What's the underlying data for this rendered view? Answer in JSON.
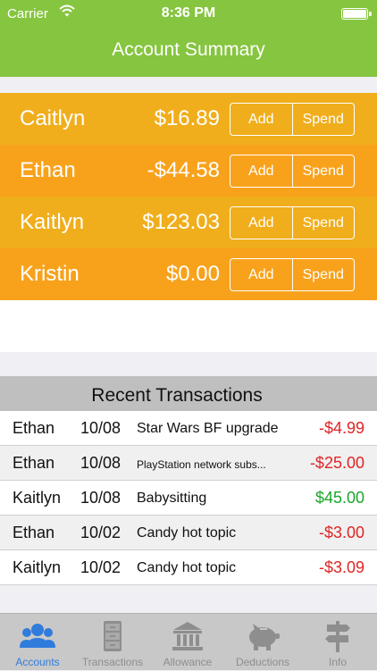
{
  "status": {
    "carrier": "Carrier",
    "time": "8:36 PM"
  },
  "header": {
    "title": "Account Summary"
  },
  "accounts": [
    {
      "name": "Caitlyn",
      "balance": "$16.89",
      "add": "Add",
      "spend": "Spend",
      "color": "#f0ae1c"
    },
    {
      "name": "Ethan",
      "balance": "-$44.58",
      "add": "Add",
      "spend": "Spend",
      "color": "#f8a21c"
    },
    {
      "name": "Kaitlyn",
      "balance": "$123.03",
      "add": "Add",
      "spend": "Spend",
      "color": "#f0ae1c"
    },
    {
      "name": "Kristin",
      "balance": "$0.00",
      "add": "Add",
      "spend": "Spend",
      "color": "#f8a21c"
    }
  ],
  "recent": {
    "title": "Recent Transactions",
    "rows": [
      {
        "who": "Ethan",
        "date": "10/08",
        "desc": "Star Wars BF upgrade",
        "amount": "-$4.99",
        "color": "#e02424"
      },
      {
        "who": "Ethan",
        "date": "10/08",
        "desc": "PlayStation network subs...",
        "amount": "-$25.00",
        "color": "#e02424"
      },
      {
        "who": "Kaitlyn",
        "date": "10/08",
        "desc": "Babysitting",
        "amount": "$45.00",
        "color": "#1aa52a"
      },
      {
        "who": "Ethan",
        "date": "10/02",
        "desc": "Candy hot topic",
        "amount": "-$3.00",
        "color": "#e02424"
      },
      {
        "who": "Kaitlyn",
        "date": "10/02",
        "desc": "Candy hot topic",
        "amount": "-$3.09",
        "color": "#e02424"
      }
    ]
  },
  "tabs": [
    {
      "label": "Accounts",
      "icon": "people-icon",
      "active": true
    },
    {
      "label": "Transactions",
      "icon": "file-cabinet-icon",
      "active": false
    },
    {
      "label": "Allowance",
      "icon": "bank-icon",
      "active": false
    },
    {
      "label": "Deductions",
      "icon": "piggy-bank-icon",
      "active": false
    },
    {
      "label": "Info",
      "icon": "signpost-icon",
      "active": false
    }
  ],
  "colors": {
    "header": "#86c540",
    "tab_active": "#2f7cdc",
    "tab_inactive": "#8e8e8e"
  }
}
